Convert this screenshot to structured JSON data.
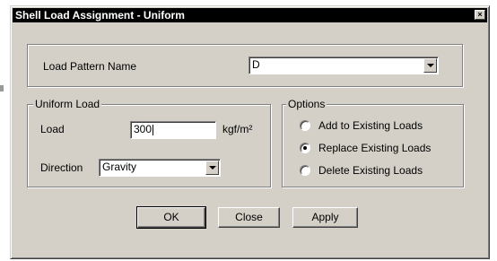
{
  "window": {
    "title": "Shell Load Assignment - Uniform",
    "close_glyph": "×"
  },
  "load_pattern": {
    "label": "Load Pattern Name",
    "value": "D"
  },
  "uniform_load": {
    "group_label": "Uniform Load",
    "load_label": "Load",
    "load_value": "300",
    "load_unit": "kgf/m²",
    "direction_label": "Direction",
    "direction_value": "Gravity"
  },
  "options": {
    "group_label": "Options",
    "items": [
      {
        "label": "Add to Existing Loads",
        "checked": false
      },
      {
        "label": "Replace Existing Loads",
        "checked": true
      },
      {
        "label": "Delete Existing Loads",
        "checked": false
      }
    ]
  },
  "buttons": {
    "ok": "OK",
    "close": "Close",
    "apply": "Apply"
  }
}
